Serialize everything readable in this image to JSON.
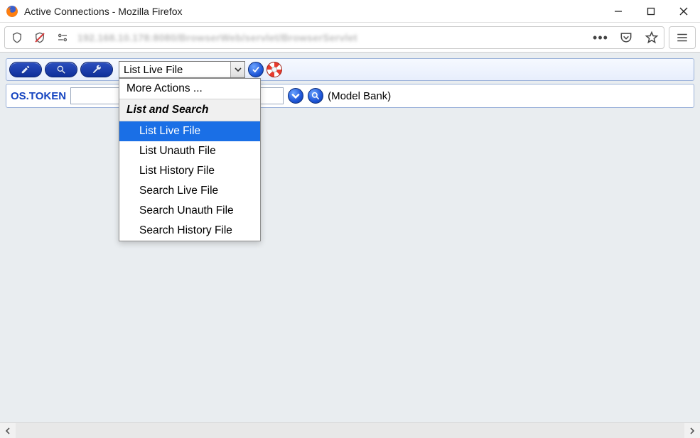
{
  "window": {
    "title": "Active Connections - Mozilla Firefox"
  },
  "urlbar": {
    "blurred_text": "192.168.10.178:8080/BrowserWeb/servlet/BrowserServlet",
    "ellipsis": "•••"
  },
  "toolbar": {
    "combo_value": "List Live File"
  },
  "dropdown": {
    "more_label": "More Actions ...",
    "group_label": "List and Search",
    "items": [
      "List Live File",
      "List Unauth File",
      "List History File",
      "Search Live File",
      "Search Unauth File",
      "Search History File"
    ],
    "selected_index": 0
  },
  "form": {
    "field_label": "OS.TOKEN",
    "field_value": "",
    "context_text": "(Model Bank)"
  }
}
